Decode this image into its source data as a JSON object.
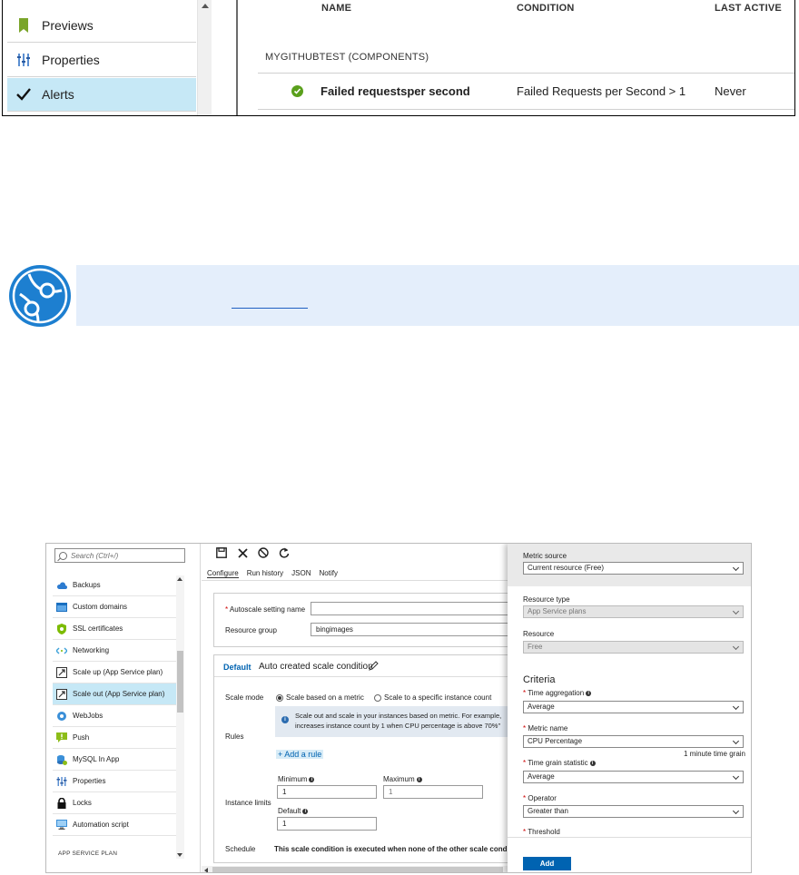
{
  "alerts_screenshot": {
    "nav_items": [
      {
        "label": "Previews",
        "icon": "bookmark-icon"
      },
      {
        "label": "Properties",
        "icon": "sliders-icon"
      },
      {
        "label": "Alerts",
        "icon": "checkmark-icon",
        "active": true
      }
    ],
    "columns": {
      "name": "NAME",
      "condition": "CONDITION",
      "last_active": "LAST ACTIVE"
    },
    "group_label": "MYGITHUBTEST (COMPONENTS)",
    "rows": [
      {
        "status_icon": "success-check-icon",
        "name": "Failed requestsper second",
        "condition": "Failed Requests per Second > 1",
        "last_active": "Never"
      }
    ]
  },
  "tip": {
    "icon": "tip-logo-icon"
  },
  "autoscale_screenshot": {
    "search_placeholder": "Search (Ctrl+/)",
    "nav_items": [
      {
        "label": "Backups",
        "icon": "cloud-icon"
      },
      {
        "label": "Custom domains",
        "icon": "domain-icon"
      },
      {
        "label": "SSL certificates",
        "icon": "shield-icon"
      },
      {
        "label": "Networking",
        "icon": "network-icon"
      },
      {
        "label": "Scale up (App Service plan)",
        "icon": "scale-up-icon"
      },
      {
        "label": "Scale out (App Service plan)",
        "icon": "scale-out-icon",
        "active": true
      },
      {
        "label": "WebJobs",
        "icon": "webjobs-icon"
      },
      {
        "label": "Push",
        "icon": "push-icon"
      },
      {
        "label": "MySQL In App",
        "icon": "mysql-icon"
      },
      {
        "label": "Properties",
        "icon": "sliders-icon"
      },
      {
        "label": "Locks",
        "icon": "lock-icon"
      },
      {
        "label": "Automation script",
        "icon": "automation-icon"
      }
    ],
    "section_footer": "APP SERVICE PLAN",
    "toolbar": {
      "save": "save-icon",
      "discard": "close-icon",
      "disable": "disable-icon",
      "refresh": "refresh-icon"
    },
    "tabs": [
      "Configure",
      "Run history",
      "JSON",
      "Notify"
    ],
    "form": {
      "setting_name_label": "Autoscale setting name",
      "setting_name_value": "",
      "resource_group_label": "Resource group",
      "resource_group_value": "bingimages"
    },
    "condition": {
      "default_label": "Default",
      "name": "Auto created scale condition",
      "scale_mode_label": "Scale mode",
      "scale_mode_metric": "Scale based on a metric",
      "scale_mode_count": "Scale to a specific instance count",
      "rules_label": "Rules",
      "info_line1": "Scale out and scale in your instances based on metric. For example,",
      "info_line2": "increases instance count by 1 when CPU percentage is above 70%\"",
      "add_rule": "+ Add a rule",
      "instance_limits_label": "Instance limits",
      "minimum_label": "Minimum",
      "minimum_value": "1",
      "maximum_label": "Maximum",
      "maximum_value": "1",
      "default_count_label": "Default",
      "default_count_value": "1",
      "schedule_label": "Schedule",
      "schedule_text": "This scale condition is executed when none of the other scale conditi"
    },
    "rule_panel": {
      "metric_source_label": "Metric source",
      "metric_source_value": "Current resource (Free)",
      "resource_type_label": "Resource type",
      "resource_type_value": "App Service plans",
      "resource_label": "Resource",
      "resource_value": "Free",
      "criteria_title": "Criteria",
      "time_aggregation_label": "Time aggregation",
      "time_aggregation_value": "Average",
      "metric_name_label": "Metric name",
      "metric_name_value": "CPU Percentage",
      "time_grain_note": "1 minute time grain",
      "time_grain_statistic_label": "Time grain statistic",
      "time_grain_statistic_value": "Average",
      "operator_label": "Operator",
      "operator_value": "Greater than",
      "threshold_label": "Threshold",
      "add_button": "Add"
    }
  }
}
